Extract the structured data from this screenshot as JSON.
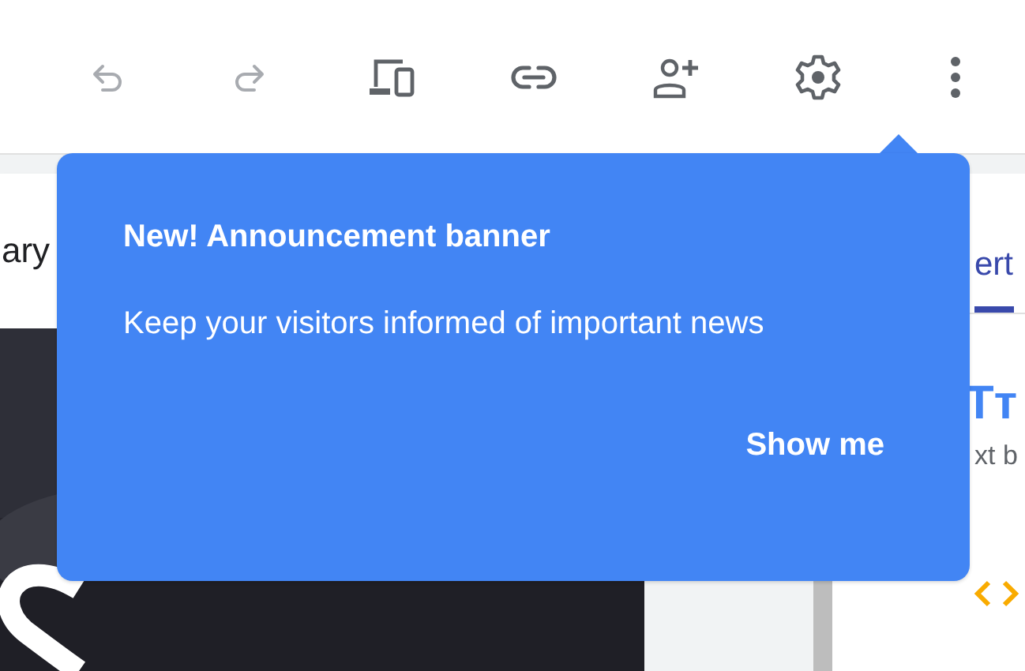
{
  "toolbar": {
    "buttons": [
      {
        "kind": "undo",
        "disabled": true
      },
      {
        "kind": "redo",
        "disabled": true
      },
      {
        "kind": "devices",
        "disabled": false
      },
      {
        "kind": "link",
        "disabled": false
      },
      {
        "kind": "share",
        "disabled": false
      },
      {
        "kind": "settings",
        "disabled": false
      },
      {
        "kind": "more",
        "disabled": false
      }
    ]
  },
  "preview": {
    "header_text": "ary"
  },
  "side_panel": {
    "tab": {
      "label": "ert",
      "selected": true
    },
    "item_icon": "Tт",
    "item_text": "xt b"
  },
  "popup": {
    "title": "New! Announcement banner",
    "body": "Keep your visitors informed of important news",
    "action": "Show me"
  }
}
